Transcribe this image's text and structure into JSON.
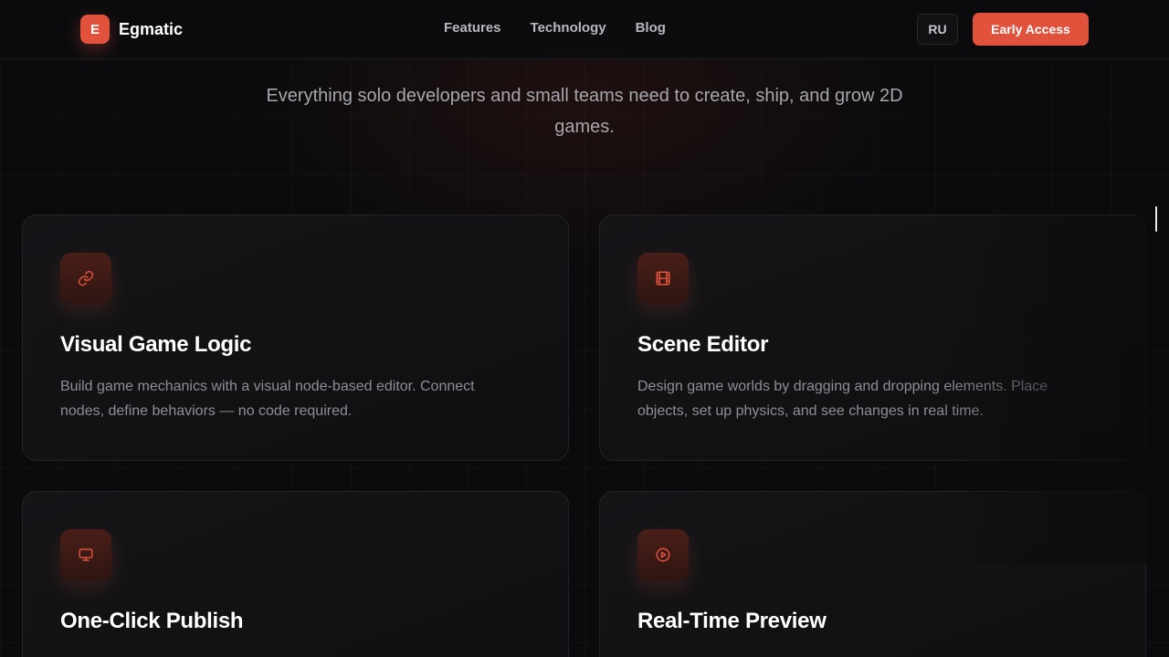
{
  "header": {
    "logo_letter": "E",
    "brand": "Egmatic",
    "nav": [
      "Features",
      "Technology",
      "Blog"
    ],
    "lang": "RU",
    "cta": "Early Access"
  },
  "hero": {
    "subtitle": "Everything solo developers and small teams need to create, ship, and grow 2D games."
  },
  "features": [
    {
      "icon": "link-icon",
      "title": "Visual Game Logic",
      "description": "Build game mechanics with a visual node-based editor. Connect nodes, define behaviors — no code required."
    },
    {
      "icon": "film-icon",
      "title": "Scene Editor",
      "description": "Design game worlds by dragging and dropping elements. Place objects, set up physics, and see changes in real time."
    },
    {
      "icon": "monitor-icon",
      "title": "One-Click Publish",
      "description": ""
    },
    {
      "icon": "play-circle-icon",
      "title": "Real-Time Preview",
      "description": ""
    }
  ],
  "colors": {
    "accent": "#e0523c",
    "background": "#0b0b0d",
    "card": "#151518"
  }
}
